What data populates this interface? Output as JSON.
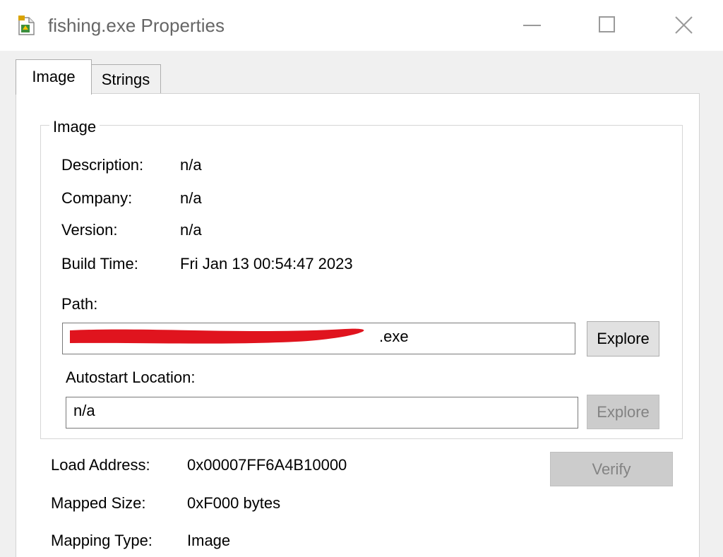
{
  "window": {
    "title": "fishing.exe Properties",
    "icon": "application-icon",
    "controls": {
      "minimize": "minimize-icon",
      "maximize": "maximize-icon",
      "close": "close-icon"
    }
  },
  "tabs": [
    {
      "label": "Image",
      "selected": true
    },
    {
      "label": "Strings",
      "selected": false
    }
  ],
  "image_group": {
    "label": "Image",
    "fields": {
      "description": {
        "label": "Description:",
        "value": "n/a"
      },
      "company": {
        "label": "Company:",
        "value": "n/a"
      },
      "version": {
        "label": "Version:",
        "value": "n/a"
      },
      "build_time": {
        "label": "Build Time:",
        "value": "Fri Jan 13 00:54:47 2023"
      }
    },
    "path": {
      "label": "Path:",
      "value": ".exe",
      "redacted": true,
      "redaction_color": "#e0141e",
      "explore_label": "Explore"
    },
    "autostart": {
      "label": "Autostart Location:",
      "value": "n/a",
      "explore_label": "Explore",
      "explore_enabled": false
    }
  },
  "details": {
    "load_address": {
      "label": "Load Address:",
      "value": "0x00007FF6A4B10000"
    },
    "mapped_size": {
      "label": "Mapped Size:",
      "value": "0xF000 bytes"
    },
    "mapping_type": {
      "label": "Mapping Type:",
      "value": "Image"
    },
    "verify_label": "Verify",
    "verify_enabled": false
  }
}
